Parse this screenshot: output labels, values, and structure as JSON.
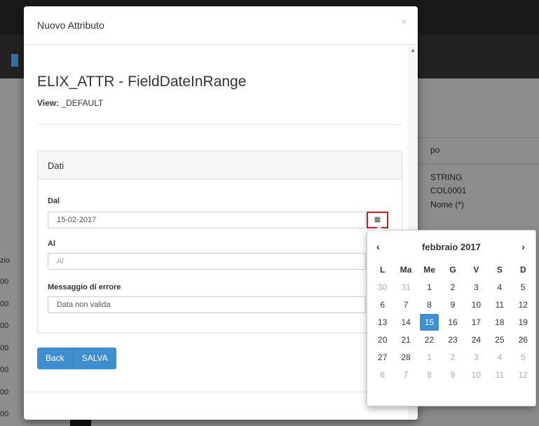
{
  "background": {
    "left_labels": [
      "zio",
      "00",
      "00",
      "00",
      "00",
      "00",
      "00",
      "00"
    ],
    "right_header": "po",
    "right_values": [
      "STRING",
      "COL0001",
      "Nome (*)"
    ]
  },
  "modal": {
    "title": "Nuovo Attributo",
    "close_glyph": "×",
    "attribute_title": "ELIX_ATTR - FieldDateInRange",
    "view_label": "View:",
    "view_value": "_DEFAULT",
    "panel_title": "Dati",
    "fields": {
      "dal_label": "Dal",
      "dal_value": "15-02-2017",
      "al_label": "Al",
      "al_placeholder": "Al",
      "msg_label": "Messaggio di errore",
      "msg_value": "Data non valida"
    },
    "calendar_icon": "calendar-icon",
    "buttons": {
      "back": "Back",
      "save": "SALVA"
    }
  },
  "datepicker": {
    "prev": "‹",
    "next": "›",
    "month_label": "febbraio 2017",
    "weekdays": [
      "L",
      "Ma",
      "Me",
      "G",
      "V",
      "S",
      "D"
    ],
    "selected_day": "15",
    "accent_color": "#3e8ed0",
    "weeks": [
      [
        {
          "d": "30",
          "m": true
        },
        {
          "d": "31",
          "m": true
        },
        {
          "d": "1"
        },
        {
          "d": "2"
        },
        {
          "d": "3"
        },
        {
          "d": "4"
        },
        {
          "d": "5"
        }
      ],
      [
        {
          "d": "6"
        },
        {
          "d": "7"
        },
        {
          "d": "8"
        },
        {
          "d": "9"
        },
        {
          "d": "10"
        },
        {
          "d": "11"
        },
        {
          "d": "12"
        }
      ],
      [
        {
          "d": "13"
        },
        {
          "d": "14"
        },
        {
          "d": "15",
          "s": true
        },
        {
          "d": "16"
        },
        {
          "d": "17"
        },
        {
          "d": "18"
        },
        {
          "d": "19"
        }
      ],
      [
        {
          "d": "20"
        },
        {
          "d": "21"
        },
        {
          "d": "22"
        },
        {
          "d": "23"
        },
        {
          "d": "24"
        },
        {
          "d": "25"
        },
        {
          "d": "26"
        }
      ],
      [
        {
          "d": "27"
        },
        {
          "d": "28"
        },
        {
          "d": "1",
          "m": true
        },
        {
          "d": "2",
          "m": true
        },
        {
          "d": "3",
          "m": true
        },
        {
          "d": "4",
          "m": true
        },
        {
          "d": "5",
          "m": true
        }
      ],
      [
        {
          "d": "6",
          "m": true
        },
        {
          "d": "7",
          "m": true
        },
        {
          "d": "8",
          "m": true
        },
        {
          "d": "9",
          "m": true
        },
        {
          "d": "10",
          "m": true
        },
        {
          "d": "11",
          "m": true
        },
        {
          "d": "12",
          "m": true
        }
      ]
    ]
  }
}
